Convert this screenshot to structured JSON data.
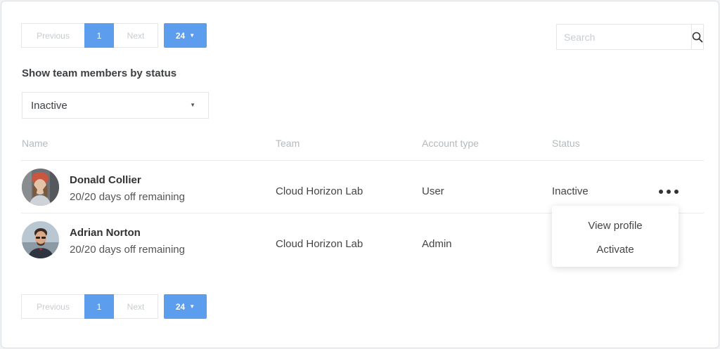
{
  "pagination": {
    "previous_label": "Previous",
    "current_page": "1",
    "next_label": "Next",
    "page_size": "24"
  },
  "search": {
    "placeholder": "Search"
  },
  "filter": {
    "title": "Show team members by status",
    "selected": "Inactive"
  },
  "table": {
    "columns": [
      "Name",
      "Team",
      "Account type",
      "Status"
    ],
    "rows": [
      {
        "name": "Donald Collier",
        "days_off": "20/20 days off remaining",
        "team": "Cloud Horizon Lab",
        "account_type": "User",
        "status": "Inactive"
      },
      {
        "name": "Adrian Norton",
        "days_off": "20/20 days off remaining",
        "team": "Cloud Horizon Lab",
        "account_type": "Admin",
        "status": ""
      }
    ]
  },
  "row_menu": {
    "items": [
      "View profile",
      "Activate"
    ]
  },
  "colors": {
    "accent": "#5c9ded",
    "muted_text": "#b5b9be",
    "border": "#e4e6e9"
  },
  "icons": {
    "search": "search-icon",
    "caret": "caret-down-icon",
    "more": "more-horizontal-icon"
  }
}
